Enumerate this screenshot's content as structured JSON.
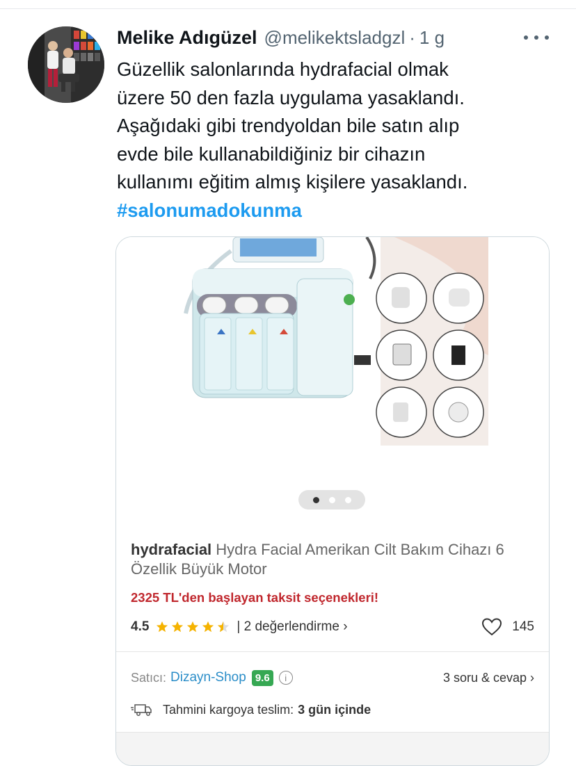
{
  "tweet": {
    "author_name": "Melike Adıgüzel",
    "handle": "@melikektsladgzl",
    "separator": "·",
    "time": "1 g",
    "text_lines": [
      "Güzellik salonlarında hydrafacial olmak",
      "üzere 50 den fazla uygulama yasaklandı.",
      "Aşağıdaki gibi trendyoldan bile satın alıp",
      "evde bile kullanabildiğiniz bir cihazın",
      "kullanımı eğitim almış kişilere yasaklandı."
    ],
    "hashtag": "#salonumadokunma"
  },
  "product": {
    "brand": "hydrafacial",
    "title": "Hydra Facial Amerikan Cilt Bakım Cihazı 6 Özellik Büyük Motor",
    "installment": "2325 TL'den başlayan taksit seçenekleri!",
    "rating": "4.5",
    "rating_stars": 4.5,
    "reviews_link": "| 2 değerlendirme ›",
    "favorites_count": "145",
    "carousel_pages": 3,
    "carousel_active": 1
  },
  "seller": {
    "label": "Satıcı:",
    "name": "Dizayn-Shop",
    "score": "9.6",
    "qa_link": "3 soru & cevap ›"
  },
  "delivery": {
    "label": "Tahmini kargoya teslim:",
    "value": "3 gün içinde"
  },
  "colors": {
    "hashtag": "#1d9bf0",
    "installment": "#c0272d",
    "seller_link": "#2a8dc8",
    "score_badge": "#36a853",
    "star": "#f5b301"
  },
  "icons": [
    "more-icon",
    "star-icon",
    "heart-icon",
    "info-icon",
    "truck-icon"
  ]
}
